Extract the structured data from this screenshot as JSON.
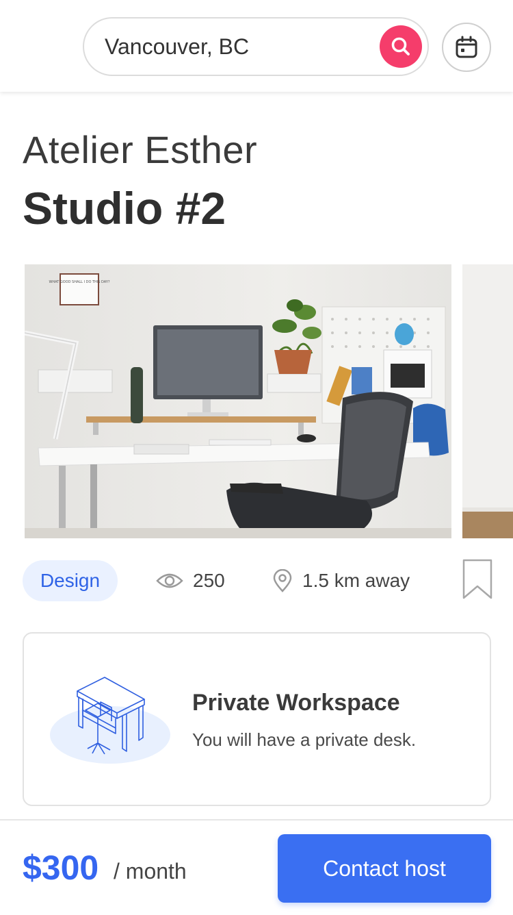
{
  "search": {
    "location": "Vancouver, BC"
  },
  "listing": {
    "host_name": "Atelier Esther",
    "space_name": "Studio #2",
    "category": "Design",
    "views": "250",
    "distance": "1.5 km away",
    "photo_sign_text": "WHAT GOOD SHALL I DO THIS DAY?"
  },
  "workspace": {
    "title": "Private Workspace",
    "description": "You will have a private desk."
  },
  "footer": {
    "price": "$300",
    "period": "/ month",
    "cta_label": "Contact host"
  },
  "colors": {
    "accent": "#3a6ff2",
    "search_button": "#f53d6b",
    "tag_bg": "#eaf1ff"
  },
  "icons": [
    "search-icon",
    "calendar-icon",
    "eye-icon",
    "location-pin-icon",
    "bookmark-icon",
    "desk-illustration"
  ]
}
